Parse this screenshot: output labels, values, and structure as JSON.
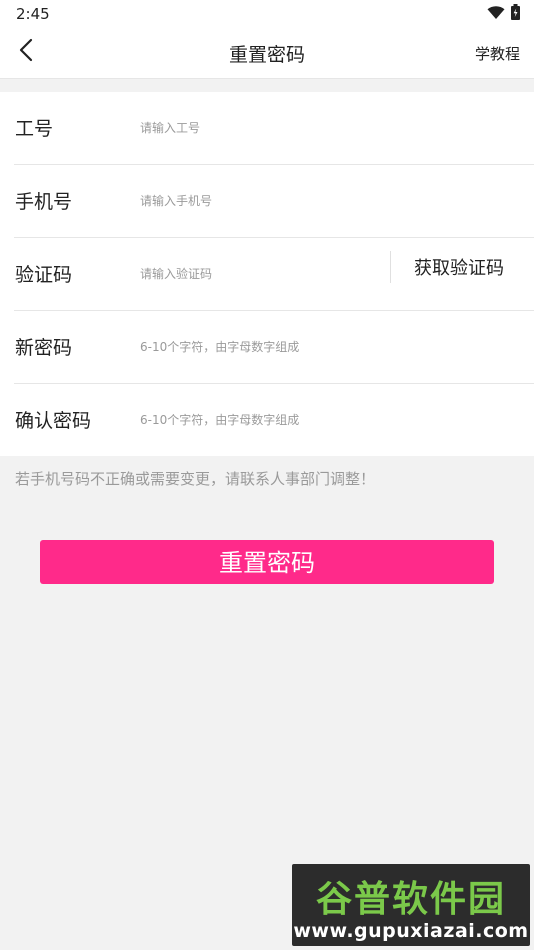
{
  "status_bar": {
    "time": "2:45",
    "icons": [
      "wifi-icon",
      "battery-icon"
    ]
  },
  "navbar": {
    "back_icon": "chevron-left-icon",
    "title": "重置密码",
    "tutorial_label": "学教程"
  },
  "form": {
    "rows": [
      {
        "label": "工号",
        "placeholder": "请输入工号",
        "value": ""
      },
      {
        "label": "手机号",
        "placeholder": "请输入手机号",
        "value": ""
      },
      {
        "label": "验证码",
        "placeholder": "请输入验证码",
        "value": ""
      },
      {
        "label": "新密码",
        "placeholder": "6-10个字符，由字母数字组成",
        "value": ""
      },
      {
        "label": "确认密码",
        "placeholder": "6-10个字符，由字母数字组成",
        "value": ""
      }
    ],
    "get_code_label": "获取验证码"
  },
  "hint": "若手机号码不正确或需要变更，请联系人事部门调整！",
  "submit_label": "重置密码",
  "watermark": {
    "main": "谷普软件园",
    "url": "www.gupuxiazai.com"
  },
  "colors": {
    "accent": "#ff2a8a",
    "background": "#f2f2f2",
    "watermark_green": "#7bc94a"
  }
}
